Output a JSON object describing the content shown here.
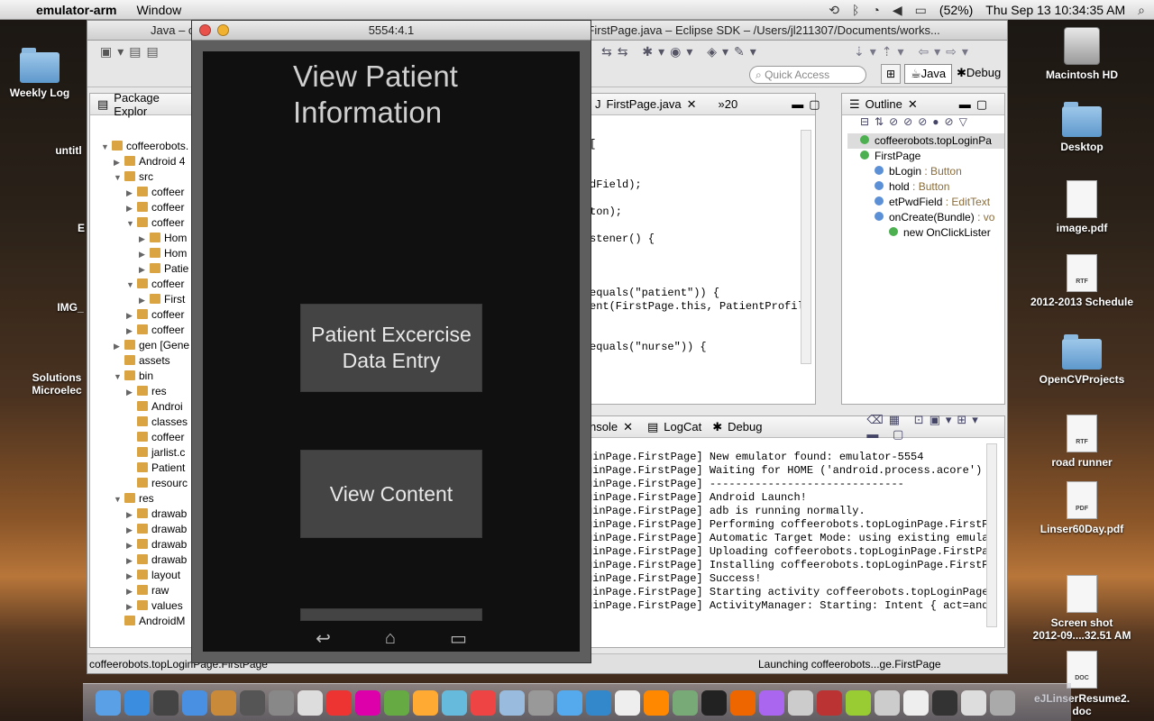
{
  "menubar": {
    "app_name": "emulator-arm",
    "menus": [
      "Window"
    ],
    "battery": "(52%)",
    "clock": "Thu Sep 13  10:34:35 AM"
  },
  "desktop": {
    "icons_left": [
      {
        "label": "Weekly Log",
        "icon": "folder-icon"
      },
      {
        "label": "untitl",
        "icon": "folder-icon"
      },
      {
        "label": "E",
        "icon": "folder-icon"
      },
      {
        "label": "IMG_",
        "icon": "image-file-icon"
      },
      {
        "label": "Solutions",
        "label2": "Microelec",
        "icon": "document-icon"
      }
    ],
    "icons_right": [
      {
        "label": "Macintosh HD",
        "icon": "hard-drive-icon"
      },
      {
        "label": "Desktop",
        "icon": "folder-icon"
      },
      {
        "label": "image.pdf",
        "icon": "document-icon",
        "badge": ""
      },
      {
        "label": "2012-2013 Schedule",
        "icon": "document-icon",
        "badge": "RTF"
      },
      {
        "label": "OpenCVProjects",
        "icon": "folder-icon"
      },
      {
        "label": "road runner",
        "icon": "document-icon",
        "badge": "RTF"
      },
      {
        "label": "Linser60Day.pdf",
        "icon": "document-icon",
        "badge": "PDF"
      },
      {
        "label": "Screen shot",
        "label2": "2012-09....32.51 AM",
        "icon": "screenshot-file-icon"
      },
      {
        "label": "eJLinserResume2.",
        "label2": "doc",
        "icon": "document-icon",
        "badge": "DOC"
      }
    ]
  },
  "eclipse": {
    "title_left": "Java – c",
    "title_right": "FirstPage.java – Eclipse SDK – /Users/jl211307/Documents/works...",
    "quick_access_placeholder": "Quick Access",
    "perspectives": [
      "Java",
      "Debug"
    ],
    "package_explorer": {
      "tab_label": "Package Explor",
      "rows": [
        {
          "text": "coffeerobots.",
          "indent": 0,
          "arrow": "▼"
        },
        {
          "text": "Android 4",
          "indent": 1,
          "arrow": "▶"
        },
        {
          "text": "src",
          "indent": 1,
          "arrow": "▼"
        },
        {
          "text": "coffeer",
          "indent": 2,
          "arrow": "▶"
        },
        {
          "text": "coffeer",
          "indent": 2,
          "arrow": "▶"
        },
        {
          "text": "coffeer",
          "indent": 2,
          "arrow": "▼"
        },
        {
          "text": "Hom",
          "indent": 3,
          "arrow": "▶"
        },
        {
          "text": "Hom",
          "indent": 3,
          "arrow": "▶"
        },
        {
          "text": "Patie",
          "indent": 3,
          "arrow": "▶"
        },
        {
          "text": "coffeer",
          "indent": 2,
          "arrow": "▼"
        },
        {
          "text": "First",
          "indent": 3,
          "arrow": "▶"
        },
        {
          "text": "coffeer",
          "indent": 2,
          "arrow": "▶"
        },
        {
          "text": "coffeer",
          "indent": 2,
          "arrow": "▶"
        },
        {
          "text": "gen [Gene",
          "indent": 1,
          "arrow": "▶"
        },
        {
          "text": "assets",
          "indent": 1,
          "arrow": ""
        },
        {
          "text": "bin",
          "indent": 1,
          "arrow": "▼"
        },
        {
          "text": "res",
          "indent": 2,
          "arrow": "▶"
        },
        {
          "text": "Androi",
          "indent": 2,
          "arrow": ""
        },
        {
          "text": "classes",
          "indent": 2,
          "arrow": ""
        },
        {
          "text": "coffeer",
          "indent": 2,
          "arrow": ""
        },
        {
          "text": "jarlist.c",
          "indent": 2,
          "arrow": ""
        },
        {
          "text": "Patient",
          "indent": 2,
          "arrow": ""
        },
        {
          "text": "resourc",
          "indent": 2,
          "arrow": ""
        },
        {
          "text": "res",
          "indent": 1,
          "arrow": "▼"
        },
        {
          "text": "drawab",
          "indent": 2,
          "arrow": "▶"
        },
        {
          "text": "drawab",
          "indent": 2,
          "arrow": "▶"
        },
        {
          "text": "drawab",
          "indent": 2,
          "arrow": "▶"
        },
        {
          "text": "drawab",
          "indent": 2,
          "arrow": "▶"
        },
        {
          "text": "layout",
          "indent": 2,
          "arrow": "▶"
        },
        {
          "text": "raw",
          "indent": 2,
          "arrow": "▶"
        },
        {
          "text": "values",
          "indent": 2,
          "arrow": "▶"
        },
        {
          "text": "AndroidM",
          "indent": 1,
          "arrow": ""
        }
      ]
    },
    "editor": {
      "tab_label": "FirstPage.java",
      "overflow_label": "»20",
      "lines": [
        "",
        "[",
        "",
        "",
        "dField);",
        "",
        "ton);",
        "",
        "stener() {",
        "",
        "",
        "",
        "equals(\"patient\")) {",
        "ent(FirstPage.this, PatientProfil",
        "",
        "",
        "equals(\"nurse\")) {"
      ]
    },
    "outline": {
      "tab_label": "Outline",
      "rows": [
        {
          "text": "coffeerobots.topLoginPa",
          "type": "",
          "indent": 0
        },
        {
          "text": "FirstPage",
          "type": "",
          "indent": 0
        },
        {
          "text": "bLogin",
          "type": ": Button",
          "indent": 1
        },
        {
          "text": "hold",
          "type": ": Button",
          "indent": 1
        },
        {
          "text": "etPwdField",
          "type": ": EditText",
          "indent": 1
        },
        {
          "text": "onCreate(Bundle)",
          "type": ": vo",
          "indent": 1
        },
        {
          "text": "new OnClickLister",
          "type": "",
          "indent": 2
        }
      ]
    },
    "console": {
      "tabs": [
        "nsole",
        "LogCat",
        "Debug"
      ],
      "lines": [
        "ginPage.FirstPage] New emulator found: emulator-5554",
        "ginPage.FirstPage] Waiting for HOME ('android.process.acore') t",
        "ginPage.FirstPage] ------------------------------",
        "ginPage.FirstPage] Android Launch!",
        "ginPage.FirstPage] adb is running normally.",
        "ginPage.FirstPage] Performing coffeerobots.topLoginPage.FirstPa",
        "ginPage.FirstPage] Automatic Target Mode: using existing emulat",
        "ginPage.FirstPage] Uploading coffeerobots.topLoginPage.FirstPag",
        "ginPage.FirstPage] Installing coffeerobots.topLoginPage.FirstPa",
        "ginPage.FirstPage] Success!",
        "ginPage.FirstPage] Starting activity coffeerobots.topLoginPage.",
        "ginPage.FirstPage] ActivityManager: Starting: Intent { act=andr"
      ]
    },
    "status_left": "coffeerobots.topLoginPage.FirstPage",
    "status_right": "Launching coffeerobots...ge.FirstPage"
  },
  "emulator": {
    "title": "5554:4.1",
    "app_title": "View Patient Information",
    "buttons": [
      "Patient Excercise Data Entry",
      "View Content"
    ]
  },
  "dock": {
    "apps": [
      "finder-icon",
      "safari-icon",
      "dashboard-icon",
      "itunes-icon",
      "garageband-icon",
      "time-machine-icon",
      "system-preferences-icon",
      "textedit-icon",
      "java-icon",
      "color-picker-icon",
      "eclipse-icon",
      "photo-icon",
      "messages-icon",
      "chrome-icon",
      "preview-icon",
      "disk-utility-icon",
      "mail-icon",
      "xcode-icon",
      "calendar-icon",
      "vlc-icon",
      "grapher-icon",
      "terminal-icon",
      "firefox-icon",
      "itunes-u-icon",
      "text-editor-icon",
      "photo-booth-icon",
      "android-icon",
      "files-icon",
      "notes-icon",
      "screen-icon",
      "preview-doc-icon",
      "trash-icon"
    ]
  }
}
